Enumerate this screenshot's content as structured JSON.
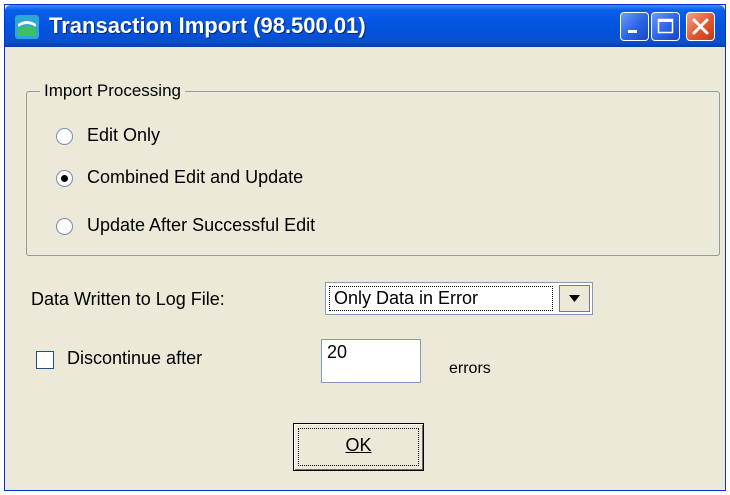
{
  "window": {
    "title": "Transaction Import (98.500.01)",
    "title_bar_color": "#0a5fe8",
    "face_color": "#ece9d8",
    "controls": {
      "minimize_icon": "minimize-icon",
      "maximize_icon": "maximize-icon",
      "close_icon": "close-icon"
    }
  },
  "import_processing": {
    "label": "Import Processing",
    "options": [
      {
        "label": "Edit Only",
        "selected": false
      },
      {
        "label": "Combined Edit and Update",
        "selected": true
      },
      {
        "label": "Update After Successful Edit",
        "selected": false
      }
    ]
  },
  "log_file": {
    "label": "Data Written to Log File:",
    "selected_value": "Only Data in Error"
  },
  "discontinue": {
    "label": "Discontinue after",
    "checked": false,
    "value": "20",
    "suffix": "errors"
  },
  "ok_button": {
    "label": "OK"
  }
}
